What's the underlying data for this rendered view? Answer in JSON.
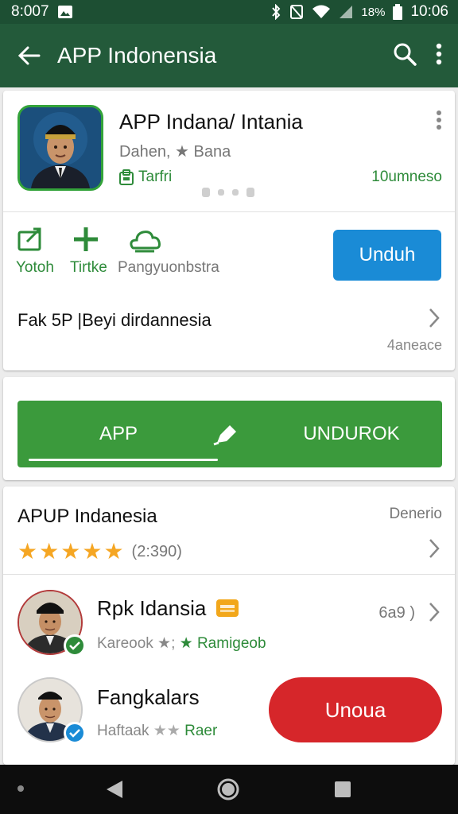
{
  "status_bar": {
    "time_left": "8:007",
    "battery": "18%",
    "time_right": "10:06"
  },
  "app_bar": {
    "title": "APP Indonensia"
  },
  "app": {
    "name": "APP Indana/ Intania",
    "developer": "Dahen, ★ Bana",
    "tag": "Tarfri",
    "count": "10umneso"
  },
  "actions": [
    {
      "label": "Yotoh",
      "icon": "share-icon"
    },
    {
      "label": "Tirtke",
      "icon": "plus-icon"
    },
    {
      "label": "Pangyuonbstra",
      "icon": "cloud-icon"
    }
  ],
  "primary_button": "Unduh",
  "description": {
    "text": "Fak 5P |Beyi dirdannesia",
    "sub": "4aneace"
  },
  "tabs": {
    "left": "APP",
    "right": "UNDUROK"
  },
  "list": {
    "title": "APUP Indanesia",
    "right": "Denerio",
    "rating": {
      "stars": 5,
      "count": "(2:390)"
    },
    "items": [
      {
        "name": "Rpk Idansia",
        "sub_a": "Kareook ★;",
        "sub_b": "★ Ramigeob",
        "right": "6a9 )"
      },
      {
        "name": "Fangkalars",
        "sub_a": "Haftaak",
        "sub_b": "Raer",
        "button": "Unoua"
      }
    ]
  },
  "colors": {
    "status": "#1d4f33",
    "appbar": "#235a3a",
    "accent_green": "#3b9a3c",
    "blue": "#1a8bd6",
    "red": "#d6262a",
    "star": "#f5a623"
  }
}
